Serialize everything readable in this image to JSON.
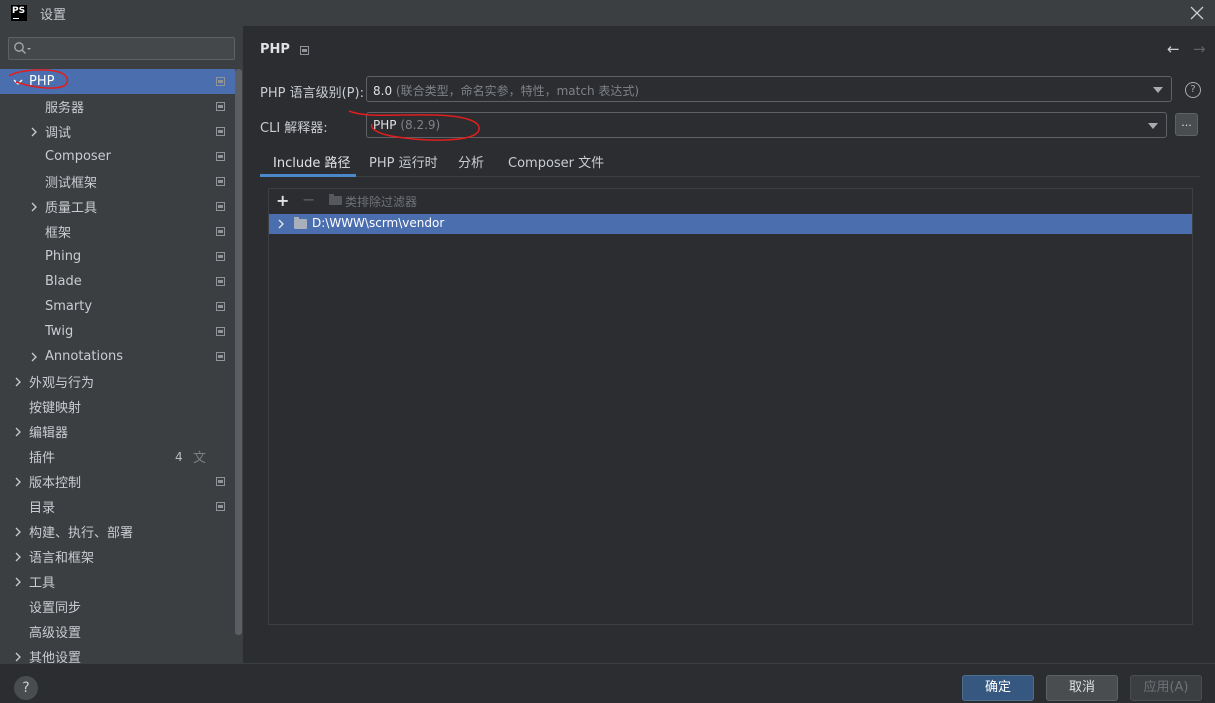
{
  "window": {
    "title": "设置",
    "app_icon": "PS"
  },
  "search": {
    "placeholder": ""
  },
  "sidebar": {
    "items": [
      {
        "label": "PHP",
        "level": 0,
        "expandable": true,
        "expanded": true,
        "selected": true,
        "project": true
      },
      {
        "label": "服务器",
        "level": 1,
        "expandable": false,
        "project": true
      },
      {
        "label": "调试",
        "level": 1,
        "expandable": true,
        "project": true
      },
      {
        "label": "Composer",
        "level": 1,
        "expandable": false,
        "project": true
      },
      {
        "label": "测试框架",
        "level": 1,
        "expandable": false,
        "project": true
      },
      {
        "label": "质量工具",
        "level": 1,
        "expandable": true,
        "project": true
      },
      {
        "label": "框架",
        "level": 1,
        "expandable": false,
        "project": true
      },
      {
        "label": "Phing",
        "level": 1,
        "expandable": false,
        "project": true
      },
      {
        "label": "Blade",
        "level": 1,
        "expandable": false,
        "project": true
      },
      {
        "label": "Smarty",
        "level": 1,
        "expandable": false,
        "project": true
      },
      {
        "label": "Twig",
        "level": 1,
        "expandable": false,
        "project": true
      },
      {
        "label": "Annotations",
        "level": 1,
        "expandable": true,
        "project": true
      },
      {
        "label": "外观与行为",
        "level": 0,
        "expandable": true,
        "project": false
      },
      {
        "label": "按键映射",
        "level": 0,
        "expandable": false,
        "project": false
      },
      {
        "label": "编辑器",
        "level": 0,
        "expandable": true,
        "project": false
      },
      {
        "label": "插件",
        "level": 0,
        "expandable": false,
        "project": false,
        "count": "4",
        "translate_icon": true
      },
      {
        "label": "版本控制",
        "level": 0,
        "expandable": true,
        "project": true
      },
      {
        "label": "目录",
        "level": 0,
        "expandable": false,
        "project": true
      },
      {
        "label": "构建、执行、部署",
        "level": 0,
        "expandable": true,
        "project": false
      },
      {
        "label": "语言和框架",
        "level": 0,
        "expandable": true,
        "project": false
      },
      {
        "label": "工具",
        "level": 0,
        "expandable": true,
        "project": false
      },
      {
        "label": "设置同步",
        "level": 0,
        "expandable": false,
        "project": false
      },
      {
        "label": "高级设置",
        "level": 0,
        "expandable": false,
        "project": false
      },
      {
        "label": "其他设置",
        "level": 0,
        "expandable": true,
        "project": false
      }
    ]
  },
  "content": {
    "breadcrumb": "PHP",
    "language_level": {
      "label": "PHP 语言级别(P):",
      "value": "8.0",
      "value_hint": "(联合类型，命名实参，特性，match 表达式)"
    },
    "cli_interpreter": {
      "label": "CLI 解释器:",
      "value": "PHP",
      "value_hint": "(8.2.9)",
      "browse_label": "..."
    },
    "tabs": [
      {
        "label": "Include 路径",
        "active": true
      },
      {
        "label": "PHP 运行时",
        "active": false
      },
      {
        "label": "分析",
        "active": false
      },
      {
        "label": "Composer 文件",
        "active": false
      }
    ],
    "toolbar": {
      "exclude_label": "类排除过滤器"
    },
    "include_paths": [
      "D:\\WWW\\scrm\\vendor"
    ]
  },
  "footer": {
    "help": "?",
    "ok_label": "确定",
    "cancel_label": "取消",
    "apply_label": "应用(A)"
  },
  "colors": {
    "selection": "#4b6eaf",
    "background": "#2b2d30",
    "sidebar": "#3c3f41",
    "primary_button": "#365880",
    "annotation": "#e01e1e"
  }
}
